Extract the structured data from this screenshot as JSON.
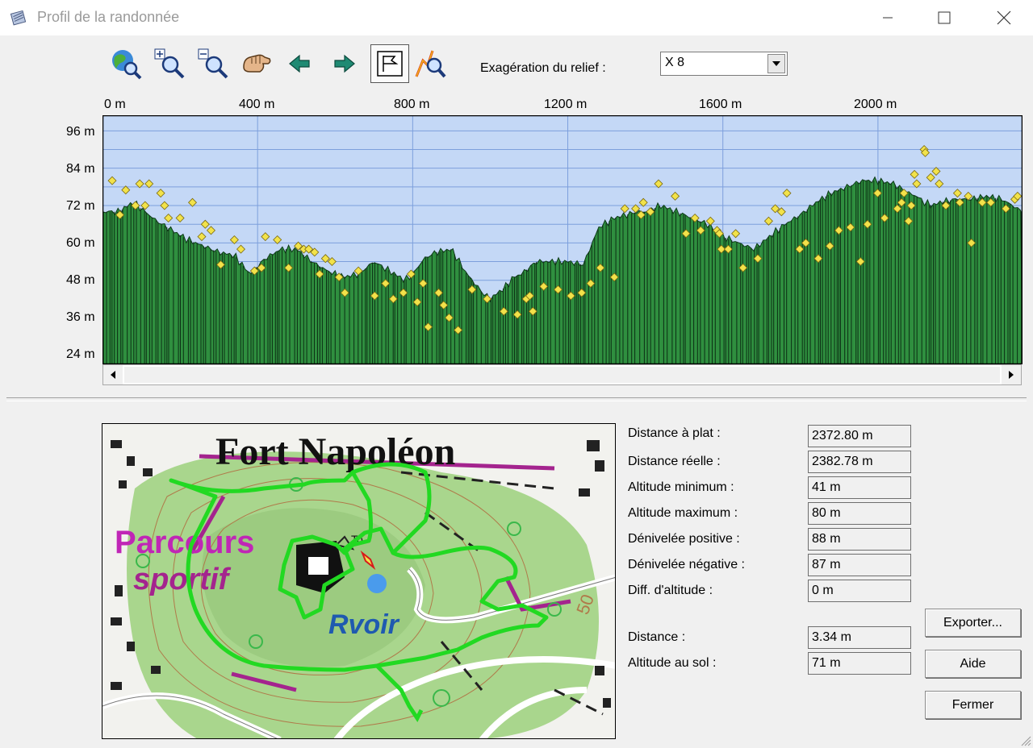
{
  "window": {
    "title": "Profil de la randonnée",
    "minimize_icon": "minimize-icon",
    "maximize_icon": "maximize-icon",
    "close_icon": "close-icon"
  },
  "toolbar": {
    "tools": [
      {
        "name": "globe-zoom-icon"
      },
      {
        "name": "zoom-in-icon"
      },
      {
        "name": "zoom-out-icon"
      },
      {
        "name": "pan-hand-icon"
      },
      {
        "name": "arrow-left-icon"
      },
      {
        "name": "arrow-right-icon"
      },
      {
        "name": "flag-mode-icon",
        "active": true
      },
      {
        "name": "profile-zoom-icon"
      }
    ],
    "exaggeration_label": "Exagération du relief :",
    "exaggeration_value": "X 8"
  },
  "chart_data": {
    "type": "area",
    "x_ticks": [
      "0 m",
      "400 m",
      "800 m",
      "1200 m",
      "1600 m",
      "2000 m"
    ],
    "y_ticks": [
      "96 m",
      "84 m",
      "72 m",
      "60 m",
      "48 m",
      "36 m",
      "24 m"
    ],
    "xlim": [
      0,
      2372.8
    ],
    "ylim": [
      21,
      101
    ],
    "grid": true,
    "profile": {
      "x": [
        0,
        40,
        80,
        110,
        140,
        180,
        220,
        260,
        300,
        340,
        380,
        420,
        460,
        500,
        540,
        580,
        620,
        660,
        700,
        740,
        780,
        800,
        830,
        860,
        900,
        940,
        980,
        1000,
        1040,
        1060,
        1080,
        1100,
        1120,
        1150,
        1200,
        1240,
        1280,
        1320,
        1350,
        1380,
        1400,
        1440,
        1480,
        1520,
        1560,
        1600,
        1640,
        1680,
        1700,
        1740,
        1760,
        1800,
        1840,
        1880,
        1920,
        1960,
        2000,
        2040,
        2080,
        2100,
        2120,
        2140,
        2160,
        2200,
        2240,
        2280,
        2320,
        2360,
        2372
      ],
      "y": [
        70,
        70,
        73,
        70,
        67,
        64,
        61,
        59,
        57,
        56,
        50,
        55,
        58,
        58,
        54,
        51,
        49,
        50,
        54,
        51,
        48,
        50,
        55,
        57,
        58,
        50,
        44,
        42,
        46,
        49,
        50,
        52,
        54,
        54,
        54,
        53,
        65,
        68,
        69,
        70,
        70,
        72,
        70,
        68,
        66,
        62,
        60,
        58,
        60,
        64,
        66,
        69,
        73,
        76,
        78,
        80,
        80,
        79,
        76,
        75,
        73,
        72,
        73,
        74,
        74,
        75,
        74,
        71,
        70
      ]
    },
    "waypoints": {
      "x": [
        25,
        45,
        60,
        85,
        96,
        110,
        120,
        150,
        160,
        170,
        200,
        232,
        256,
        265,
        280,
        305,
        340,
        357,
        392,
        410,
        420,
        451,
        480,
        505,
        519,
        532,
        547,
        560,
        575,
        592,
        610,
        625,
        660,
        702,
        730,
        750,
        776,
        796,
        812,
        827,
        840,
        867,
        880,
        894,
        917,
        953,
        992,
        1035,
        1070,
        1093,
        1102,
        1110,
        1138,
        1175,
        1208,
        1236,
        1259,
        1284,
        1320,
        1347,
        1375,
        1389,
        1395,
        1413,
        1434,
        1477,
        1505,
        1528,
        1543,
        1568,
        1585,
        1591,
        1596,
        1614,
        1633,
        1652,
        1690,
        1718,
        1735,
        1751,
        1765,
        1798,
        1814,
        1846,
        1876,
        1899,
        1929,
        1955,
        1973,
        1999,
        2017,
        2050,
        2061,
        2067,
        2079,
        2086,
        2094,
        2100,
        2119,
        2122,
        2136,
        2150,
        2158,
        2175,
        2205,
        2211,
        2233,
        2241,
        2269,
        2291,
        2330,
        2353,
        2360
      ],
      "y": [
        80,
        69,
        77,
        72,
        79,
        72,
        79,
        76,
        72,
        68,
        68,
        73,
        62,
        66,
        64,
        53,
        61,
        58,
        51,
        52,
        62,
        61,
        52,
        59,
        58,
        58,
        57,
        50,
        55,
        54,
        49,
        44,
        51,
        43,
        47,
        42,
        44,
        50,
        41,
        47,
        33,
        44,
        40,
        36,
        32,
        45,
        42,
        38,
        37,
        42,
        43,
        38,
        46,
        45,
        43,
        44,
        47,
        52,
        49,
        71,
        71,
        69,
        73,
        70,
        79,
        75,
        63,
        68,
        64,
        67,
        64,
        63,
        58,
        58,
        63,
        52,
        55,
        67,
        71,
        70,
        76,
        58,
        60,
        55,
        59,
        64,
        65,
        54,
        66,
        76,
        68,
        71,
        73,
        76,
        67,
        72,
        82,
        79,
        90,
        89,
        81,
        83,
        79,
        72,
        76,
        73,
        75,
        60,
        73,
        73,
        71,
        74,
        75
      ]
    }
  },
  "map": {
    "label_title": "Fort Napoléon",
    "label_parcours_1": "Parcours",
    "label_parcours_2": "sportif",
    "label_reservoir": "Rvoir",
    "label_contour": "50",
    "label_tower": "To"
  },
  "stats": {
    "distance_plat": {
      "label": "Distance à plat :",
      "value": "2372.80 m"
    },
    "distance_reelle": {
      "label": "Distance réelle :",
      "value": "2382.78 m"
    },
    "altitude_min": {
      "label": "Altitude minimum :",
      "value": "41 m"
    },
    "altitude_max": {
      "label": "Altitude maximum :",
      "value": "80 m"
    },
    "deniv_pos": {
      "label": "Dénivelée positive :",
      "value": "88 m"
    },
    "deniv_neg": {
      "label": "Dénivelée négative :",
      "value": "87 m"
    },
    "diff_alt": {
      "label": "Diff. d'altitude :",
      "value": "0 m"
    },
    "distance": {
      "label": "Distance :",
      "value": "3.34 m"
    },
    "altitude_sol": {
      "label": "Altitude au sol :",
      "value": "71 m"
    }
  },
  "buttons": {
    "export": "Exporter...",
    "help": "Aide",
    "close": "Fermer"
  },
  "colors": {
    "sky": "#c4d8f6",
    "terrain": "#2f8f3f",
    "grid": "#7d9fdc",
    "waypoint": "#f2e24a",
    "track": "#22d922"
  }
}
